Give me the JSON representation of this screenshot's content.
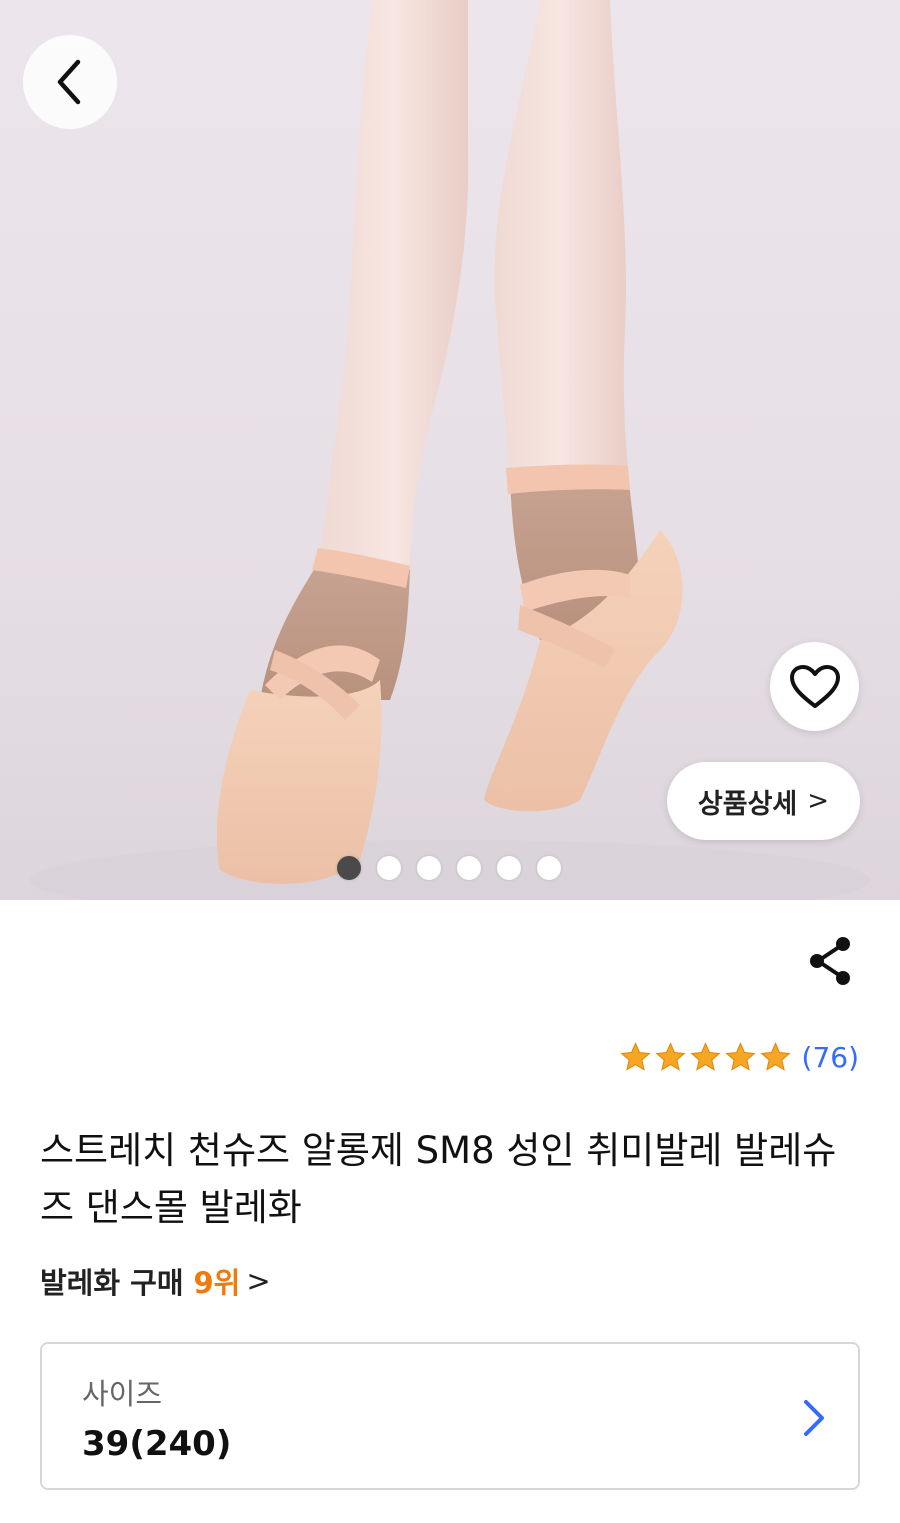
{
  "hero": {
    "image": "ballet-shoes-photo",
    "slides_total": 6,
    "slide_active": 1,
    "detail_button_label": "상품상세",
    "detail_button_chevron": ">"
  },
  "product": {
    "rating_stars": 5,
    "review_count": "(76)",
    "title": "스트레치 천슈즈 알롱제 SM8 성인 취미발레 발레슈즈 댄스몰 발레화",
    "rank_label": "발레화 구매",
    "rank_value": "9위",
    "rank_chevron": ">"
  },
  "option": {
    "label": "사이즈",
    "value": "39(240)"
  },
  "colors": {
    "accent_blue": "#346aff",
    "rank_orange": "#f07a0a",
    "star_orange": "#f5a623"
  }
}
